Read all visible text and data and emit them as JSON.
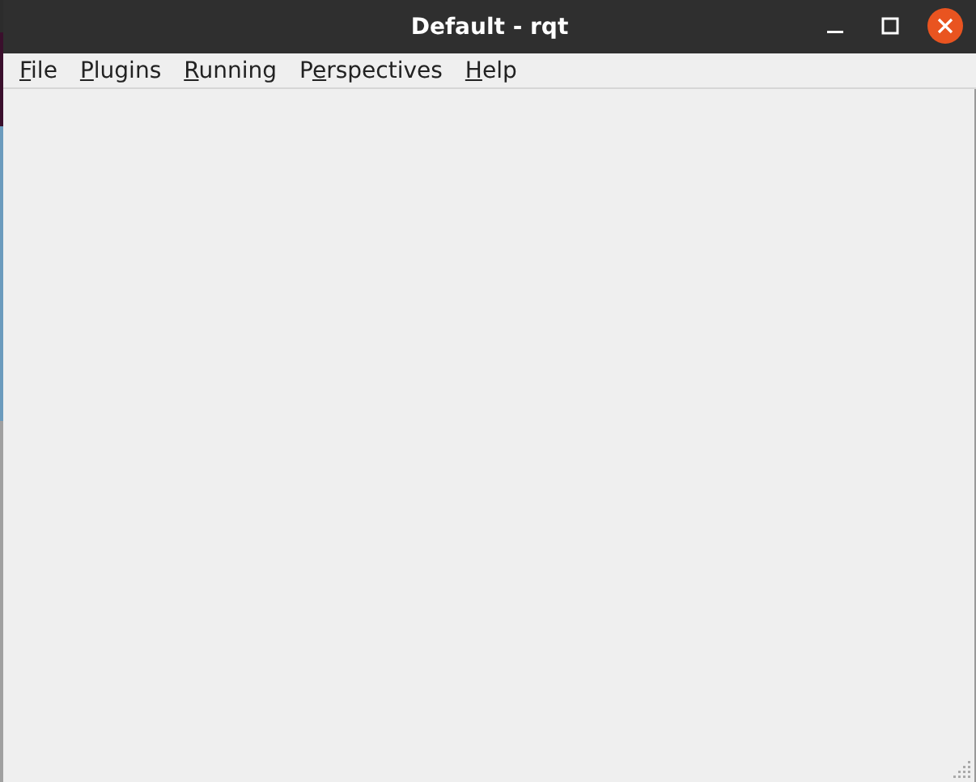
{
  "window": {
    "title": "Default - rqt"
  },
  "menu_bar": [
    {
      "parts": [
        {
          "text": "F",
          "underlined": true
        },
        {
          "text": "ile",
          "underlined": false
        }
      ]
    },
    {
      "parts": [
        {
          "text": "P",
          "underlined": true
        },
        {
          "text": "lugins",
          "underlined": false
        }
      ]
    },
    {
      "parts": [
        {
          "text": "R",
          "underlined": true
        },
        {
          "text": "unning",
          "underlined": false
        }
      ]
    },
    {
      "parts": [
        {
          "text": "P",
          "underlined": false
        },
        {
          "text": "e",
          "underlined": true
        },
        {
          "text": "rspectives",
          "underlined": false
        }
      ]
    },
    {
      "parts": [
        {
          "text": "H",
          "underlined": true
        },
        {
          "text": "elp",
          "underlined": false
        }
      ]
    }
  ]
}
